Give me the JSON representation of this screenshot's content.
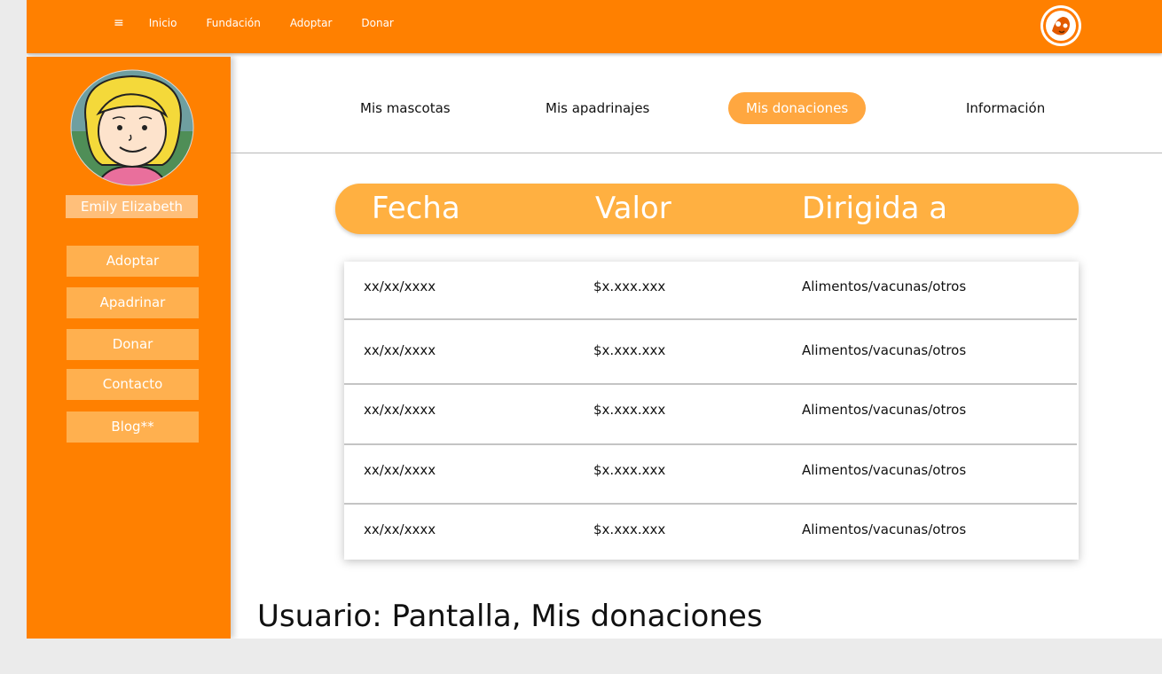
{
  "topbar": {
    "menu_icon": "≡",
    "nav": [
      "Inicio",
      "Fundación",
      "Adoptar",
      "Donar"
    ]
  },
  "sidebar": {
    "user_name": "Emily Elizabeth",
    "items": [
      "Adoptar",
      "Apadrinar",
      "Donar",
      "Contacto",
      "Blog**"
    ]
  },
  "tabs": {
    "items": [
      "Mis mascotas",
      "Mis apadrinajes",
      "Mis donaciones",
      "Información"
    ],
    "active": "Mis donaciones"
  },
  "table": {
    "headers": [
      "Fecha",
      "Valor",
      "Dirigida a"
    ],
    "rows": [
      [
        "xx/xx/xxxx",
        "$x.xxx.xxx",
        "Alimentos/vacunas/otros"
      ],
      [
        "xx/xx/xxxx",
        "$x.xxx.xxx",
        "Alimentos/vacunas/otros"
      ],
      [
        "xx/xx/xxxx",
        "$x.xxx.xxx",
        "Alimentos/vacunas/otros"
      ],
      [
        "xx/xx/xxxx",
        "$x.xxx.xxx",
        "Alimentos/vacunas/otros"
      ],
      [
        "xx/xx/xxxx",
        "$x.xxx.xxx",
        "Alimentos/vacunas/otros"
      ]
    ]
  },
  "caption": "Usuario: Pantalla, Mis donaciones",
  "colors": {
    "primary_orange": "#ff8000",
    "light_orange": "#ffb041",
    "page_bg": "#ebebeb"
  }
}
